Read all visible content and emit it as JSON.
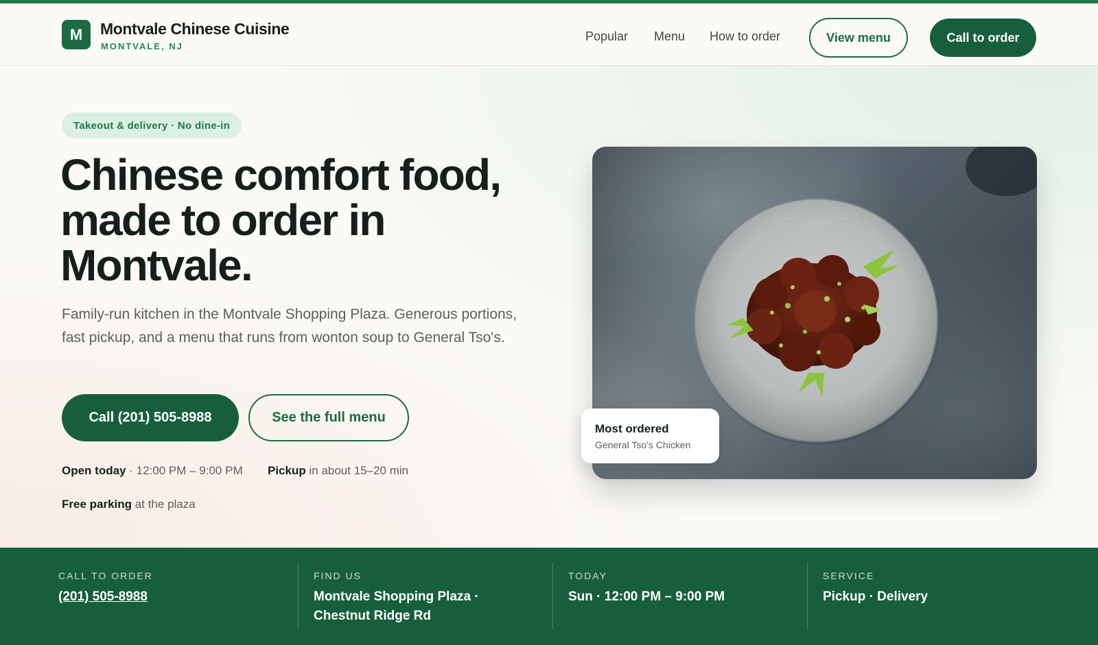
{
  "header": {
    "logo_letter": "M",
    "brand_name": "Montvale Chinese Cuisine",
    "brand_location": "MONTVALE, NJ",
    "nav": [
      {
        "label": "Popular"
      },
      {
        "label": "Menu"
      },
      {
        "label": "How to order"
      }
    ],
    "view_menu_label": "View menu",
    "call_to_order_label": "Call to order"
  },
  "hero": {
    "pill": "Takeout & delivery · No dine-in",
    "headline": "Chinese comfort food, made to order in Montvale.",
    "subcopy": "Family-run kitchen in the Montvale Shopping Plaza. Generous portions, fast pickup, and a menu that runs from wonton soup to General Tso's.",
    "call_button": "Call (201) 505-8988",
    "menu_button": "See the full menu",
    "open_label": "Open today",
    "open_value": "· 12:00 PM – 9:00 PM",
    "pickup_label": "Pickup",
    "pickup_value": "in about 15–20 min",
    "parking_label": "Free parking",
    "parking_value": "at the plaza"
  },
  "feature_badge": {
    "title": "Most ordered",
    "dish": "General Tso's Chicken"
  },
  "info_band": {
    "call": {
      "label": "CALL TO ORDER",
      "value": "(201) 505-8988"
    },
    "find": {
      "label": "FIND US",
      "value": "Montvale Shopping Plaza · Chestnut Ridge Rd"
    },
    "today": {
      "label": "TODAY",
      "value": "Sun · 12:00 PM – 9:00 PM"
    },
    "service": {
      "label": "SERVICE",
      "value": "Pickup · Delivery"
    }
  },
  "colors": {
    "brand_green": "#175f3c",
    "accent_green": "#1f8a52",
    "pill_bg": "#dcefe3",
    "page_bg": "#fbfaf7",
    "ink": "#16201a"
  },
  "icons": {
    "logo": "letter-m-logo"
  }
}
